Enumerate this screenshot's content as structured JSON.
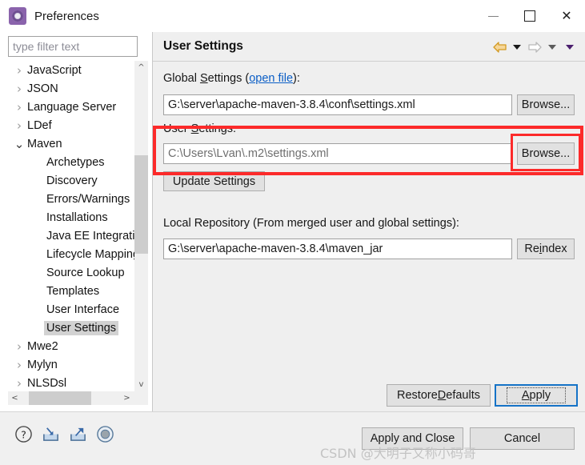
{
  "window": {
    "title": "Preferences",
    "icon": "preferences-gear-icon",
    "controls": {
      "minimize": "–",
      "maximize": "□",
      "close": "✕"
    }
  },
  "filter": {
    "placeholder": "type filter text",
    "value": ""
  },
  "tree": {
    "items": [
      {
        "label": "JavaScript",
        "level": 1,
        "expander": "collapsed",
        "selected": false
      },
      {
        "label": "JSON",
        "level": 1,
        "expander": "collapsed",
        "selected": false
      },
      {
        "label": "Language Server",
        "level": 1,
        "expander": "collapsed",
        "selected": false
      },
      {
        "label": "LDef",
        "level": 1,
        "expander": "collapsed",
        "selected": false
      },
      {
        "label": "Maven",
        "level": 1,
        "expander": "expanded",
        "selected": false
      },
      {
        "label": "Archetypes",
        "level": 2,
        "expander": "none",
        "selected": false
      },
      {
        "label": "Discovery",
        "level": 2,
        "expander": "none",
        "selected": false
      },
      {
        "label": "Errors/Warnings",
        "level": 2,
        "expander": "none",
        "selected": false
      },
      {
        "label": "Installations",
        "level": 2,
        "expander": "none",
        "selected": false
      },
      {
        "label": "Java EE Integration",
        "level": 2,
        "expander": "none",
        "selected": false
      },
      {
        "label": "Lifecycle Mappings",
        "level": 2,
        "expander": "none",
        "selected": false
      },
      {
        "label": "Source Lookup",
        "level": 2,
        "expander": "none",
        "selected": false
      },
      {
        "label": "Templates",
        "level": 2,
        "expander": "none",
        "selected": false
      },
      {
        "label": "User Interface",
        "level": 2,
        "expander": "none",
        "selected": false
      },
      {
        "label": "User Settings",
        "level": 2,
        "expander": "none",
        "selected": true
      },
      {
        "label": "Mwe2",
        "level": 1,
        "expander": "collapsed",
        "selected": false
      },
      {
        "label": "Mylyn",
        "level": 1,
        "expander": "collapsed",
        "selected": false
      },
      {
        "label": "NLSDsl",
        "level": 1,
        "expander": "collapsed",
        "selected": false
      }
    ],
    "scroll": {
      "up_arrow": "^",
      "down_arrow": "v",
      "left_arrow": "<",
      "right_arrow": ">"
    }
  },
  "panel": {
    "title": "User Settings",
    "nav": {
      "back": "back-arrow",
      "back_menu": "caret-down",
      "forward": "forward-arrow",
      "forward_menu": "caret-down",
      "view_menu": "caret-down"
    },
    "global_settings": {
      "label_prefix": "Global ",
      "label_underlined": "S",
      "label_rest": "ettings (",
      "link": "open file",
      "label_suffix": "):",
      "value": "G:\\server\\apache-maven-3.8.4\\conf\\settings.xml",
      "browse": "Browse..."
    },
    "user_settings": {
      "label_prefix": "User ",
      "label_underlined": "S",
      "label_rest": "ettings:",
      "value": "C:\\Users\\Lvan\\.m2\\settings.xml",
      "browse": "Browse..."
    },
    "update_settings_button": "Update Settings",
    "local_repository": {
      "label": "Local Repository (From merged user and global settings):",
      "value": "G:\\server\\apache-maven-3.8.4\\maven_jar",
      "reindex_prefix": "Re",
      "reindex_underlined": "i",
      "reindex_rest": "ndex"
    },
    "restore_defaults": {
      "prefix": "Restore ",
      "underlined": "D",
      "rest": "efaults"
    },
    "apply": {
      "prefix": "",
      "underlined": "A",
      "rest": "pply"
    }
  },
  "footer": {
    "icons": [
      "help-icon",
      "import-icon",
      "export-icon",
      "record-icon"
    ],
    "apply_and_close": "Apply and Close",
    "cancel": "Cancel",
    "watermark": "CSDN @大明子又称小码哥"
  },
  "colors": {
    "accent_red": "#fc2a2a",
    "link_blue": "#0b5ec6",
    "focus_blue": "#1573c7",
    "panel_bg": "#efefef",
    "selection_gray": "#d2d2d2",
    "back_arrow_gold": "#e8a33d",
    "purple_caret": "#4b1f6e"
  }
}
